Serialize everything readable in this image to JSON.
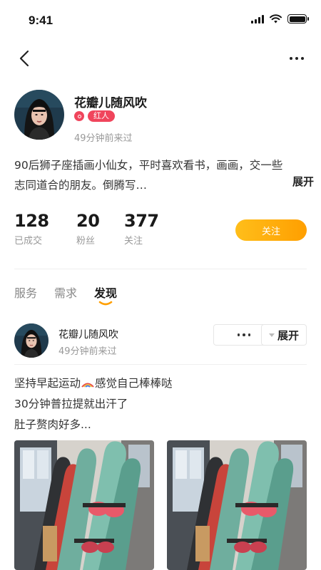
{
  "status": {
    "time": "9:41"
  },
  "profile": {
    "name": "花瓣儿随风吹",
    "badge": "红人",
    "last_seen": "49分钟前来过",
    "bio_line1": "90后狮子座插画小仙女，平时喜欢看书，画画，交一些",
    "bio_line2": "志同道合的朋友。倒腾写…",
    "expand": "展开"
  },
  "stats": [
    {
      "value": "128",
      "label": "已成交"
    },
    {
      "value": "20",
      "label": "粉丝"
    },
    {
      "value": "377",
      "label": "关注"
    }
  ],
  "follow_label": "关注",
  "tabs": [
    {
      "label": "服务",
      "active": false
    },
    {
      "label": "需求",
      "active": false
    },
    {
      "label": "发现",
      "active": true
    }
  ],
  "post": {
    "author": "花瓣儿随风吹",
    "time": "49分钟前来过",
    "expand": "展开",
    "line1_a": "坚持早起运动",
    "line1_b": "感觉自己棒棒哒",
    "line2": "30分钟普拉提就出汗了",
    "line3": "肚子赘肉好多..."
  },
  "icons": {
    "back": "chevron-left-icon",
    "more": "more-horizontal-icon",
    "badge": "influencer-badge-icon",
    "expand_caret": "caret-down-icon",
    "emoji": "rainbow-emoji-icon"
  },
  "colors": {
    "accent_orange": "#ff9f00",
    "badge_red": "#f0455c"
  }
}
